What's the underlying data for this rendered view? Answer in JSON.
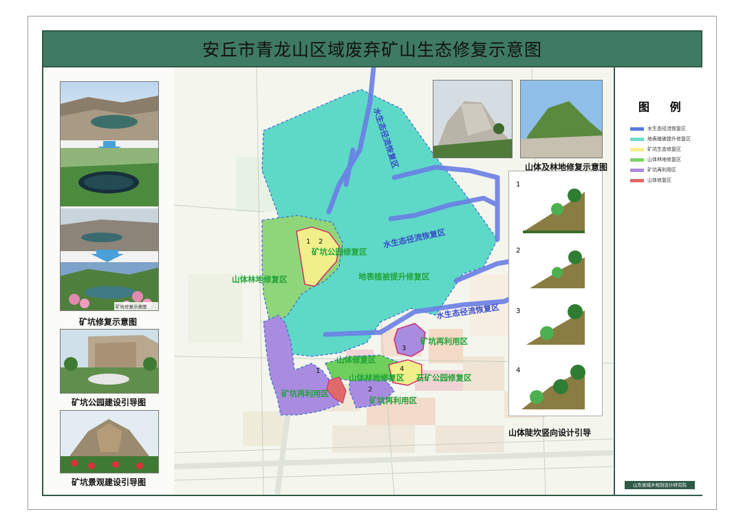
{
  "title": "安丘市青龙山区域废弃矿山生态修复示意图",
  "left_panel": {
    "pit_restore_caption": "矿坑修复示意图",
    "photo_overlay_label": "矿坑修复示意图",
    "pit_park_caption": "矿坑公园建设引导图",
    "pit_landscape_caption": "矿坑景观建设引导图"
  },
  "right_panel": {
    "mountain_forest_caption": "山体及林地修复示意图",
    "slope_caption": "山体陡坎竖向设计引导",
    "slope_steps": [
      "1",
      "2",
      "3",
      "4"
    ]
  },
  "legend": {
    "title": "图 例",
    "items": [
      {
        "label": "水生态径流恢复区",
        "color": "#5b7be0"
      },
      {
        "label": "地表植被提升修复区",
        "color": "#6fdccb"
      },
      {
        "label": "矿坑生态修复区",
        "color": "#f0ef8a"
      },
      {
        "label": "山体林地修复区",
        "color": "#7ed36a"
      },
      {
        "label": "矿坑再利用区",
        "color": "#a98be0"
      },
      {
        "label": "山体修复区",
        "color": "#e06a6a"
      }
    ],
    "organization": "山东省城乡规划设计研究院"
  },
  "map_labels": {
    "water_1": "水生态径流恢复区",
    "water_2": "水生态径流恢复区",
    "water_3": "水生态径流恢复区",
    "surface_veg": "地表植被提升修复区",
    "pit_park": "矿坑公园修复区",
    "forest_left": "山体林地修复区",
    "pit_reuse_right": "矿坑再利用区",
    "mountain_repair": "山体修复区",
    "forest_center": "山体林地修复区",
    "stone_pit_park": "石矿公园修复区",
    "pit_reuse_left": "矿坑再利用区",
    "pit_reuse_bottom": "矿坑再利用区",
    "num_1": "1",
    "num_2": "2",
    "num_3": "3",
    "num_4": "4",
    "num_1b": "1",
    "num_2b": "2"
  }
}
